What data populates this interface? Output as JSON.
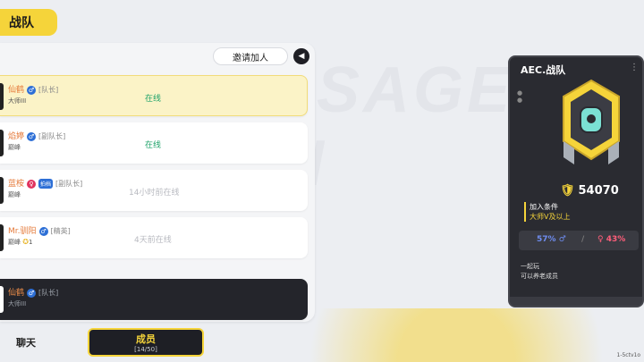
{
  "page_title": "战队",
  "background_text": "SAUSAGE MAN",
  "invite_label": "邀请加人",
  "members": [
    {
      "name": "仙鹤",
      "gender": "♂",
      "role": "[队长]",
      "rank": "大师III",
      "status": "在线",
      "tag": "",
      "stars": ""
    },
    {
      "name": "焰婷",
      "gender": "♂",
      "role": "[副队长]",
      "rank": "巅峰",
      "status": "在线",
      "tag": "",
      "stars": ""
    },
    {
      "name": "蓝桉",
      "gender": "♀",
      "role": "[副队长]",
      "rank": "巅峰",
      "status": "14小时前在线",
      "tag": "拍档",
      "stars": ""
    },
    {
      "name": "Mr.驯阳",
      "gender": "♂",
      "role": "[精英]",
      "rank": "巅峰",
      "status": "4天前在线",
      "tag": "",
      "stars": "1"
    }
  ],
  "self_member": {
    "name": "仙鹤",
    "gender": "♂",
    "role": "[队长]",
    "rank": "大师III"
  },
  "tabs": {
    "chat": "聊天",
    "members": "成员",
    "member_count": "[14/50]"
  },
  "team_card": {
    "name": "AEC.战队",
    "more_icon": "ellipsis-icon",
    "score": "54070",
    "condition_label": "加入条件",
    "condition_value": "大师V及以上",
    "male_pct": "57%",
    "female_pct": "43%",
    "slogan_line1": "一起玩",
    "slogan_line2": "可以养老成员"
  },
  "build_text": "1-5ctv1o",
  "colors": {
    "accent": "#f5d43a",
    "online": "#1fa36a",
    "male": "#2d6fd6",
    "female": "#e0335e"
  }
}
